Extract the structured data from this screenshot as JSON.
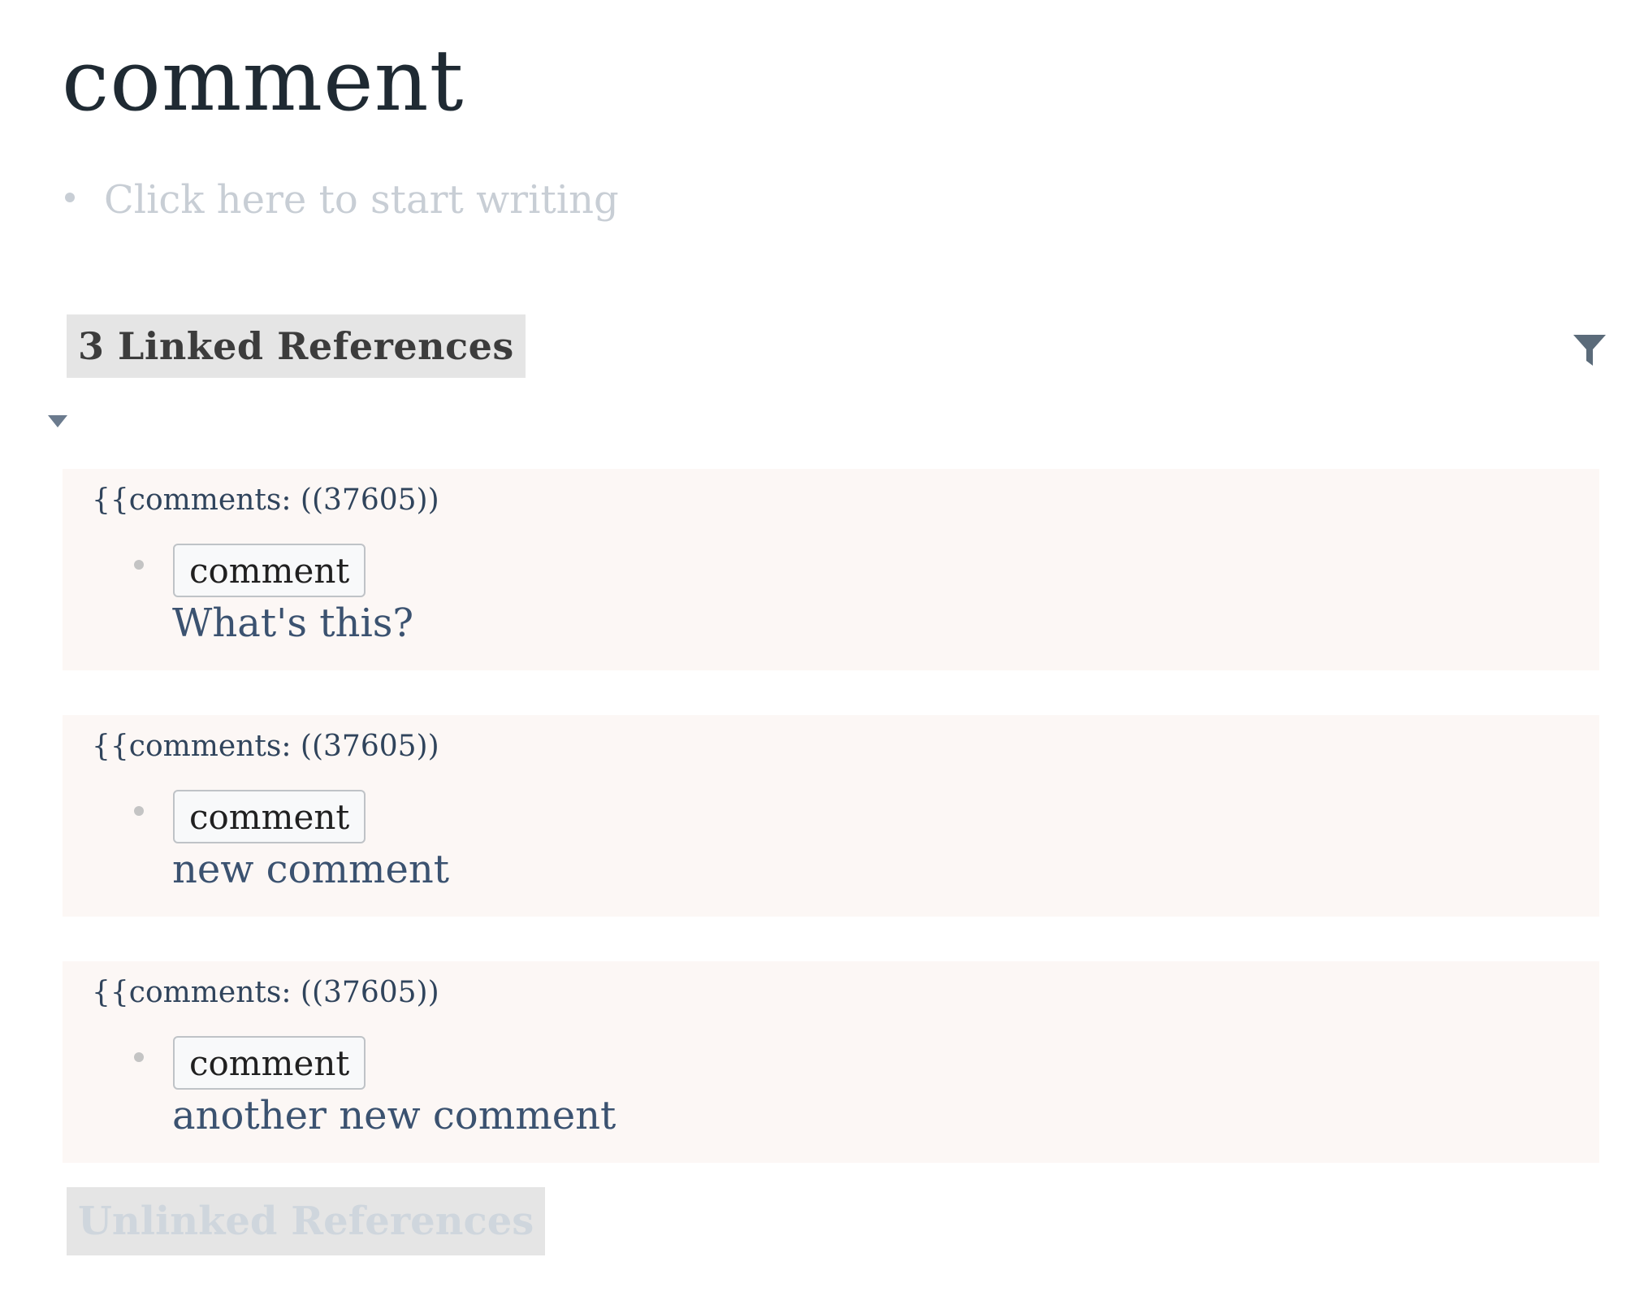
{
  "page": {
    "title": "comment"
  },
  "editor": {
    "placeholder": "Click here to start writing"
  },
  "linked_references": {
    "header": "3 Linked References",
    "filter_icon": "filter-icon",
    "collapse_icon": "triangle-down-icon",
    "items": [
      {
        "breadcrumb": "{{comments: ((37605))",
        "tag": "comment",
        "text": "What's this?"
      },
      {
        "breadcrumb": "{{comments: ((37605))",
        "tag": "comment",
        "text": "new comment"
      },
      {
        "breadcrumb": "{{comments: ((37605))",
        "tag": "comment",
        "text": "another new comment"
      }
    ]
  },
  "unlinked_references": {
    "header": "Unlinked References"
  },
  "colors": {
    "title": "#1f2a33",
    "placeholder": "#c8ced5",
    "header_bg": "#e5e5e5",
    "card_bg": "#fcf7f5",
    "ref_text": "#3b5270",
    "breadcrumb": "#30445c",
    "icon": "#5b6b7a"
  }
}
